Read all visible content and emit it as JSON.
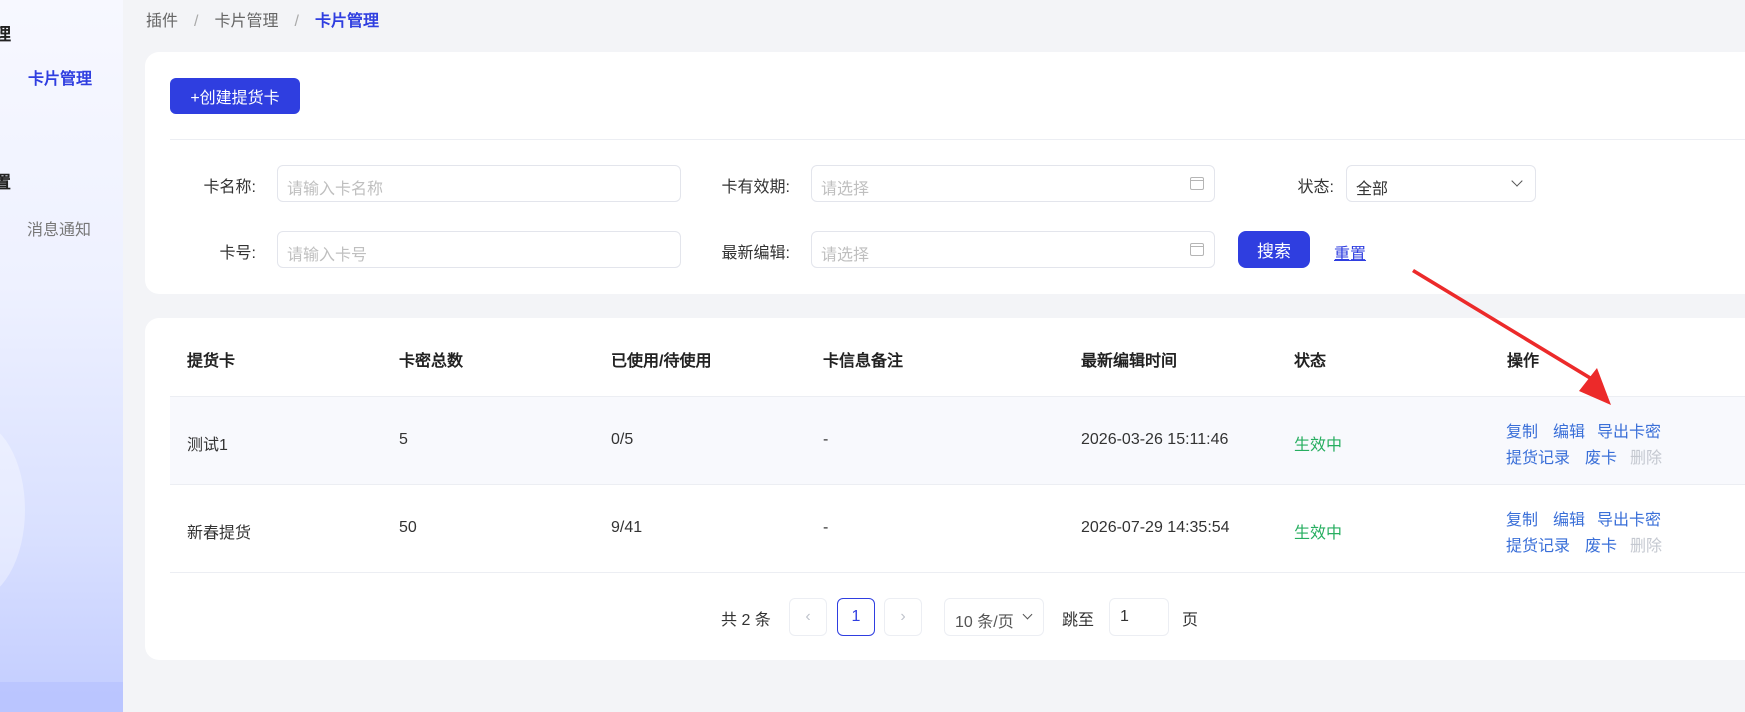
{
  "sidebar": {
    "group1": "理",
    "active_item": "卡片管理",
    "group2": "置",
    "item_msg": "消息通知"
  },
  "breadcrumb": {
    "items": [
      "插件",
      "卡片管理"
    ],
    "current": "卡片管理",
    "sep": "/"
  },
  "toolbar": {
    "create_label": "+创建提货卡"
  },
  "filters": {
    "card_name_label": "卡名称:",
    "card_name_placeholder": "请输入卡名称",
    "validity_label": "卡有效期:",
    "validity_placeholder": "请选择",
    "status_label": "状态:",
    "status_value": "全部",
    "card_no_label": "卡号:",
    "card_no_placeholder": "请输入卡号",
    "last_edit_label": "最新编辑:",
    "last_edit_placeholder": "请选择",
    "search_label": "搜索",
    "reset_label": "重置"
  },
  "table": {
    "headers": [
      "提货卡",
      "卡密总数",
      "已使用/待使用",
      "卡信息备注",
      "最新编辑时间",
      "状态",
      "操作"
    ],
    "rows": [
      {
        "name": "测试1",
        "total": "5",
        "used": "0/5",
        "note": "-",
        "time": "2026-03-26 15:11:46",
        "status": "生效中"
      },
      {
        "name": "新春提货",
        "total": "50",
        "used": "9/41",
        "note": "-",
        "time": "2026-07-29 14:35:54",
        "status": "生效中"
      }
    ],
    "ops": {
      "copy": "复制",
      "edit": "编辑",
      "export": "导出卡密",
      "records": "提货记录",
      "void": "废卡",
      "delete": "删除"
    }
  },
  "pagination": {
    "total": "共 2 条",
    "prev": "‹",
    "page": "1",
    "next": "›",
    "page_size": "10 条/页",
    "jump_label": "跳至",
    "jump_value": "1",
    "page_label": "页"
  },
  "colors": {
    "accent": "#2f3ee0",
    "status_active": "#27ae60",
    "link": "#3a6fd8",
    "arrow": "#ec2a2a"
  }
}
